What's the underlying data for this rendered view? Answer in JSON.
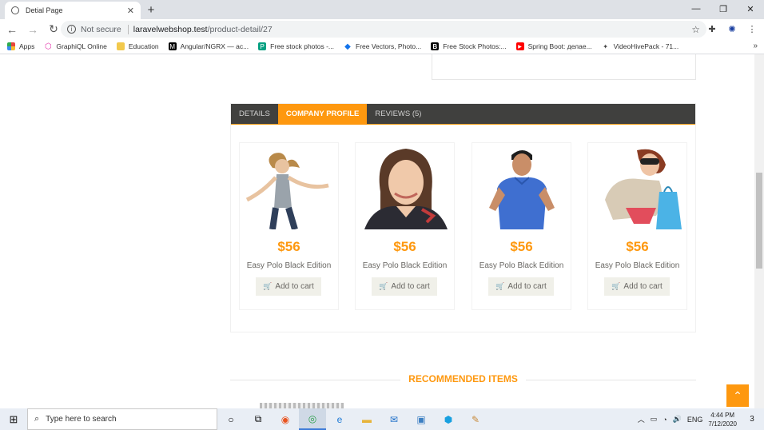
{
  "browser": {
    "tab_title": "Detial Page",
    "tab_close": "✕",
    "new_tab": "+",
    "window_controls": [
      "—",
      "❐",
      "✕"
    ],
    "url_security": "Not secure",
    "url_host": "laravelwebshop.test",
    "url_path": "/product-detail/27",
    "bookmarks": [
      {
        "label": "Apps",
        "icon": "apps-icon",
        "color": "#e8453c"
      },
      {
        "label": "GraphiQL Online",
        "icon": "graphql-icon",
        "color": "#e535ab"
      },
      {
        "label": "Education",
        "icon": "folder-icon",
        "color": "#f2c94c"
      },
      {
        "label": "Angular/NGRX — ас...",
        "icon": "medium-icon",
        "color": "#000000"
      },
      {
        "label": "Free stock photos -...",
        "icon": "pexels-icon",
        "color": "#05a081"
      },
      {
        "label": "Free Vectors, Photo...",
        "icon": "freepik-icon",
        "color": "#1273eb"
      },
      {
        "label": "Free Stock Photos:...",
        "icon": "b-icon",
        "color": "#000000"
      },
      {
        "label": "Spring Boot: делае...",
        "icon": "youtube-icon",
        "color": "#ff0000"
      },
      {
        "label": "VideoHivePack - 71...",
        "icon": "videohive-icon",
        "color": "#444444"
      }
    ],
    "bookmarks_more": "»"
  },
  "product_tabs": [
    {
      "label": "Details",
      "active": false
    },
    {
      "label": "Company Profile",
      "active": true
    },
    {
      "label": "Reviews (5)",
      "active": false
    }
  ],
  "products": [
    {
      "price": "$56",
      "name": "Easy Polo Black Edition",
      "cart_label": "Add to cart"
    },
    {
      "price": "$56",
      "name": "Easy Polo Black Edition",
      "cart_label": "Add to cart"
    },
    {
      "price": "$56",
      "name": "Easy Polo Black Edition",
      "cart_label": "Add to cart"
    },
    {
      "price": "$56",
      "name": "Easy Polo Black Edition",
      "cart_label": "Add to cart"
    }
  ],
  "recommended_title": "RECOMMENDED ITEMS",
  "scroll_top_glyph": "⌃",
  "taskbar": {
    "search_placeholder": "Type here to search",
    "language": "ENG",
    "time": "4:44 PM",
    "date": "7/12/2020",
    "notifications": "3"
  },
  "colors": {
    "accent": "#fe980f",
    "tab_bar": "#40403e",
    "cart_button": "#f0f0e9"
  }
}
